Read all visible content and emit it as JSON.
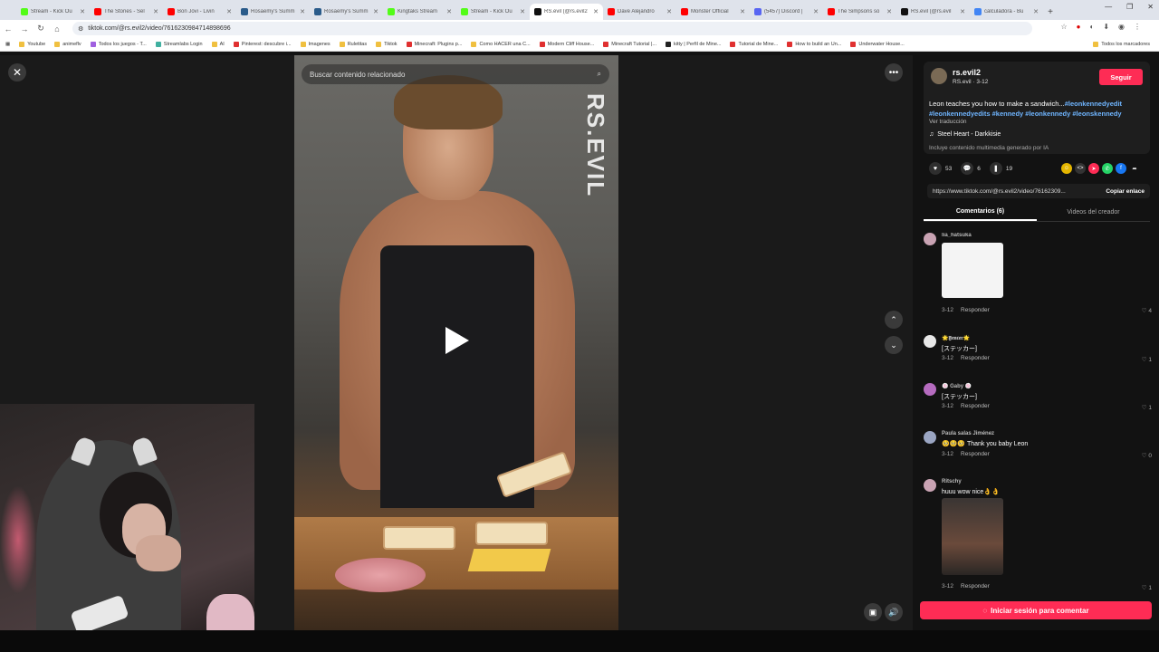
{
  "browser": {
    "tabs": [
      {
        "label": "Stream - Kick Ou",
        "color": "#53fc18"
      },
      {
        "label": "The Stones - Sel",
        "color": "#ff0000"
      },
      {
        "label": "Bon Jovi - Livin",
        "color": "#ff0000"
      },
      {
        "label": "Rosaemy's Summ",
        "color": "#2a5b8a"
      },
      {
        "label": "Rosaemy's Summ",
        "color": "#2a5b8a"
      },
      {
        "label": "Kingtaks Stream",
        "color": "#53fc18"
      },
      {
        "label": "Stream - Kick Ou",
        "color": "#53fc18"
      },
      {
        "label": "RS.evil (@rs.evil2",
        "color": "#111111"
      },
      {
        "label": "Dave Alejandro",
        "color": "#ff0000"
      },
      {
        "label": "Monster Official",
        "color": "#ff0000"
      },
      {
        "label": "(5457) Discord |",
        "color": "#5865f2"
      },
      {
        "label": "The Simpsons so",
        "color": "#ff0000"
      },
      {
        "label": "RS.evil (@rs.evil",
        "color": "#111111"
      },
      {
        "label": "calculadora - Bu",
        "color": "#4285f4"
      }
    ],
    "url": "tiktok.com/@rs.evil2/video/7616230984714898696",
    "bookmarks": [
      "Youtube",
      "animeflv",
      "Todos los juegos - T...",
      "Streamlabs Login",
      "AI",
      "Pinterest: descubre i...",
      "Imagenes",
      "Ruletitas",
      "Tiktok",
      "Minecraft: Plugins p...",
      "Como HACER una C...",
      "Modern Cliff House...",
      "Minecraft Tutorial |...",
      "kitty | Perfil de Mine...",
      "Tutorial de Mine...",
      "How to build an Un...",
      "Underwater House..."
    ],
    "bookmarks_all": "Todos los marcadores"
  },
  "video": {
    "search_placeholder": "Buscar contenido relacionado",
    "watermark": "RS.EVIL"
  },
  "panel": {
    "username": "rs.evil2",
    "sub_meta": "RS.evil · 3-12",
    "follow_label": "Seguir",
    "desc_text": "Leon teaches you how to make a sandwich...",
    "desc_tags_1": "#leonkennedyedit",
    "desc_tags_2": "#leonkennedyedits #kennedy #leonkennedy #leonskennedy",
    "translate": "Ver traducción",
    "music": "Steel Heart - Darkkisie",
    "ai_note": "Incluye contenido multimedia generado por IA",
    "likes": "53",
    "comments_count": "6",
    "saves": "19",
    "link": "https://www.tiktok.com/@rs.evil2/video/76162309...",
    "copy_label": "Copiar enlace",
    "tab_comments": "Comentarios (6)",
    "tab_creator": "Videos del creador",
    "reply_label": "Responder",
    "login_label": "Iniciar sesión para comentar"
  },
  "comments": [
    {
      "user": "lia_hatsuka",
      "text": "",
      "date": "3-12",
      "likes": "4",
      "avatar_color": "#c9a3b3"
    },
    {
      "user": "🌟𝕱𝖊𝖓𝖈𝖊𝖗🌟",
      "text": "[ステッカー]",
      "date": "3-12",
      "likes": "1",
      "avatar_color": "#e8e8e8"
    },
    {
      "user": "🍥 Gaby 🍥",
      "text": "[ステッカー]",
      "date": "3-12",
      "likes": "1",
      "avatar_color": "#b56bbf"
    },
    {
      "user": "Paula salas Jiménez",
      "text": "🥺🥺🥺 Thank you baby Leon",
      "date": "3-12",
      "likes": "0",
      "avatar_color": "#9aa5c2"
    },
    {
      "user": "Ritschy",
      "text": "huuu wow nice👌👌",
      "date": "3-12",
      "likes": "1",
      "avatar_color": "#c9a3b3"
    }
  ]
}
